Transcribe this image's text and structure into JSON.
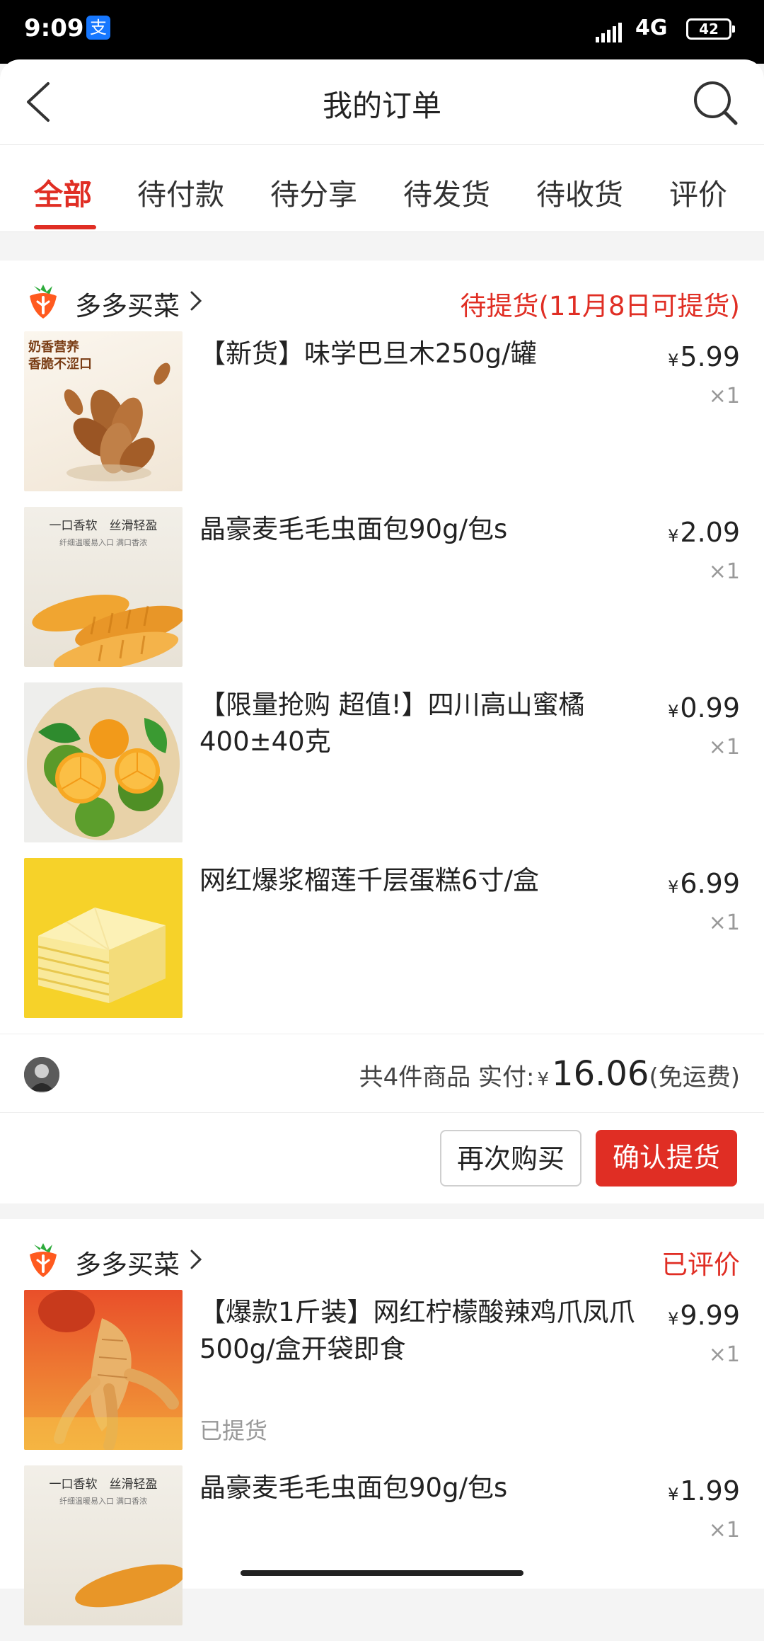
{
  "status_bar": {
    "time": "9:09",
    "alipay_glyph": "支",
    "network": "4G",
    "battery": "42"
  },
  "header": {
    "title": "我的订单"
  },
  "tabs": [
    "全部",
    "待付款",
    "待分享",
    "待发货",
    "待收货",
    "评价"
  ],
  "currency": "¥",
  "orders": [
    {
      "shop": "多多买菜",
      "status": "待提货(11月8日可提货)",
      "items": [
        {
          "title": "【新货】味学巴旦木250g/罐",
          "price": "5.99",
          "qty": "×1",
          "thumb_text_1": "奶香营养",
          "thumb_text_2": "香脆不涩口"
        },
        {
          "title": "晶豪麦毛毛虫面包90g/包s",
          "price": "2.09",
          "qty": "×1",
          "thumb_text_1": "一口香软　丝滑轻盈",
          "thumb_text_2": "纤细温暖易入口 满口香浓"
        },
        {
          "title": "【限量抢购 超值!】四川高山蜜橘400±40克",
          "price": "0.99",
          "qty": "×1"
        },
        {
          "title": "网红爆浆榴莲千层蛋糕6寸/盒",
          "price": "6.99",
          "qty": "×1"
        }
      ],
      "summary_count": "共4件商品",
      "summary_paid_label": "实付:",
      "total": "16.06",
      "shipping_note": "(免运费)",
      "buttons": {
        "rebuy": "再次购买",
        "confirm": "确认提货"
      }
    },
    {
      "shop": "多多买菜",
      "status": "已评价",
      "items": [
        {
          "title": "【爆款1斤装】网红柠檬酸辣鸡爪凤爪500g/盒开袋即食",
          "price": "9.99",
          "qty": "×1",
          "sub_status": "已提货"
        },
        {
          "title": "晶豪麦毛毛虫面包90g/包s",
          "price": "1.99",
          "qty": "×1",
          "thumb_text_1": "一口香软　丝滑轻盈",
          "thumb_text_2": "纤细温暖易入口 满口香浓"
        }
      ]
    }
  ],
  "colors": {
    "accent": "#e02e24",
    "statusbar": "#000000"
  },
  "icons": [
    "back-icon",
    "search-icon",
    "carrot-logo-icon",
    "chevron-right-icon",
    "signal-icon",
    "battery-icon",
    "alipay-icon"
  ]
}
